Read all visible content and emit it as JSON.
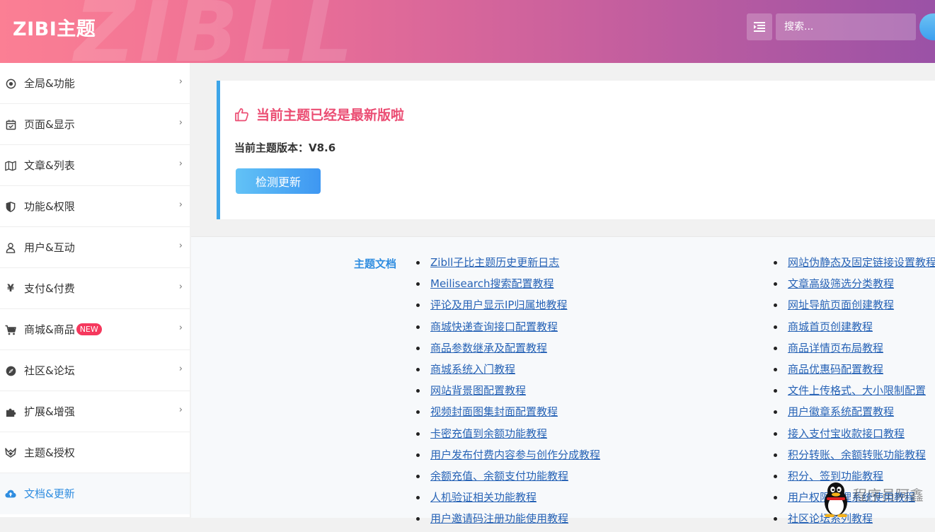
{
  "header": {
    "brand": "ZIBI主题",
    "watermark": "ZIBLL",
    "search_placeholder": "搜索..."
  },
  "sidebar": {
    "items": [
      {
        "label": "全局&功能",
        "icon": "target-icon"
      },
      {
        "label": "页面&显示",
        "icon": "calendar-icon"
      },
      {
        "label": "文章&列表",
        "icon": "map-icon"
      },
      {
        "label": "功能&权限",
        "icon": "shield-icon"
      },
      {
        "label": "用户&互动",
        "icon": "user-icon"
      },
      {
        "label": "支付&付费",
        "icon": "yen-icon"
      },
      {
        "label": "商城&商品",
        "icon": "cart-icon",
        "badge": "NEW"
      },
      {
        "label": "社区&论坛",
        "icon": "compass-icon"
      },
      {
        "label": "扩展&增强",
        "icon": "puzzle-icon"
      },
      {
        "label": "主题&授权",
        "icon": "leaf-icon"
      },
      {
        "label": "文档&更新",
        "icon": "cloud-upload-icon"
      }
    ]
  },
  "update_card": {
    "title": "当前主题已经是最新版啦",
    "version_label": "当前主题版本：V8.6",
    "check_button": "检测更新"
  },
  "docs": {
    "heading": "主题文档",
    "col1": [
      "Zibll子比主题历史更新日志",
      "Meilisearch搜索配置教程",
      "评论及用户显示IP归属地教程",
      "商城快递查询接口配置教程",
      "商品参数继承及配置教程",
      "商城系统入门教程",
      "网站背景图配置教程",
      "视频封面图集封面配置教程",
      "卡密充值到余额功能教程",
      "用户发布付费内容参与创作分成教程",
      "余额充值、余额支付功能教程",
      "人机验证相关功能教程",
      "用户邀请码注册功能使用教程"
    ],
    "col2": [
      "网站伪静态及固定链接设置教程",
      "文章高级筛选分类教程",
      "网址导航页面创建教程",
      "商城首页创建教程",
      "商品详情页布局教程",
      "商品优惠码配置教程",
      "文件上传格式、大小限制配置",
      "用户徽章系统配置教程",
      "接入支付宝收款接口教程",
      "积分转账、余额转账功能教程",
      "积分、签到功能教程",
      "用户权限管理系统使用教程",
      "社区论坛系列教程"
    ]
  },
  "watermark_text": "程序员阿鑫"
}
